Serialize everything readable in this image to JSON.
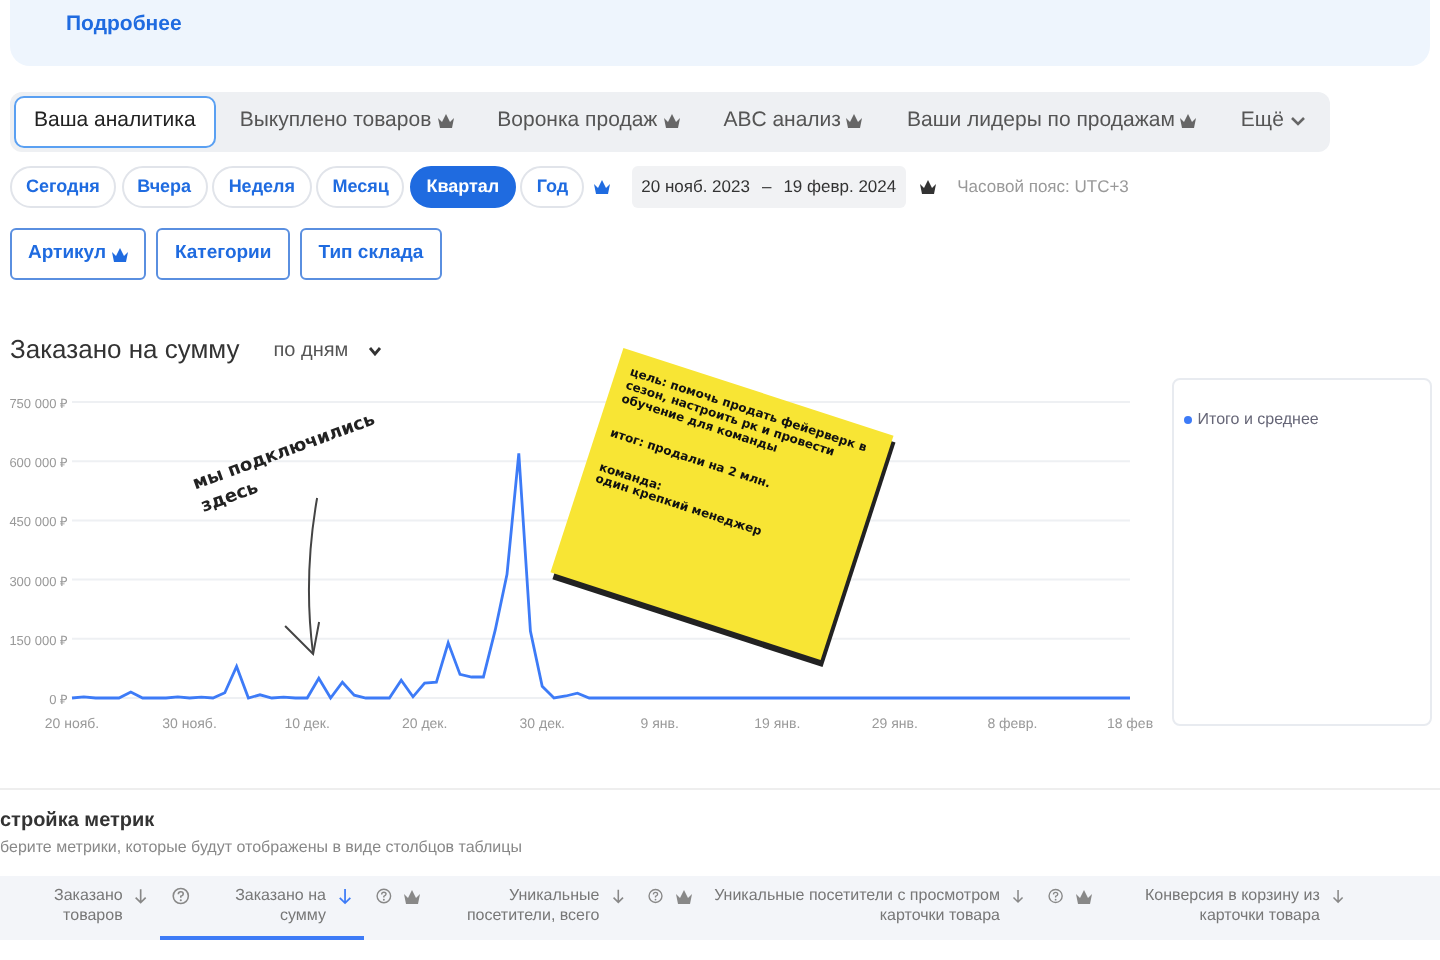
{
  "banner": {
    "link": "Подробнее"
  },
  "tabs": [
    {
      "label": "Ваша аналитика",
      "selected": true,
      "premium": false,
      "dropdown": false
    },
    {
      "label": "Выкуплено товаров",
      "selected": false,
      "premium": true,
      "dropdown": false
    },
    {
      "label": "Воронка продаж",
      "selected": false,
      "premium": true,
      "dropdown": false
    },
    {
      "label": "ABC анализ",
      "selected": false,
      "premium": true,
      "dropdown": false
    },
    {
      "label": "Ваши лидеры по продажам",
      "selected": false,
      "premium": true,
      "dropdown": false
    },
    {
      "label": "Ещё",
      "selected": false,
      "premium": false,
      "dropdown": true
    }
  ],
  "periods": [
    {
      "label": "Сегодня",
      "selected": false
    },
    {
      "label": "Вчера",
      "selected": false
    },
    {
      "label": "Неделя",
      "selected": false
    },
    {
      "label": "Месяц",
      "selected": false
    },
    {
      "label": "Квартал",
      "selected": true
    },
    {
      "label": "Год",
      "selected": false
    }
  ],
  "periods_premium": true,
  "date_range": {
    "from": "20 нояб. 2023",
    "separator": "–",
    "to": "19 февр. 2024",
    "premium": true
  },
  "timezone": "Часовой пояс: UTC+3",
  "filters": [
    {
      "label": "Артикул",
      "premium": true
    },
    {
      "label": "Категории",
      "premium": false
    },
    {
      "label": "Тип склада",
      "premium": false
    }
  ],
  "chart_section": {
    "title": "Заказано на сумму",
    "granularity": "по дням",
    "chart_data": {
      "type": "line",
      "categories": [
        "20 нояб.",
        null,
        null,
        null,
        null,
        null,
        null,
        null,
        null,
        null,
        "30 нояб.",
        null,
        null,
        null,
        null,
        null,
        null,
        null,
        null,
        null,
        "10 дек.",
        null,
        null,
        null,
        null,
        null,
        null,
        null,
        null,
        null,
        "20 дек.",
        null,
        null,
        null,
        null,
        null,
        null,
        null,
        null,
        null,
        "30 дек.",
        null,
        null,
        null,
        null,
        null,
        null,
        null,
        null,
        null,
        "9 янв.",
        null,
        null,
        null,
        null,
        null,
        null,
        null,
        null,
        null,
        "19 янв.",
        null,
        null,
        null,
        null,
        null,
        null,
        null,
        null,
        null,
        "29 янв.",
        null,
        null,
        null,
        null,
        null,
        null,
        null,
        null,
        null,
        "8 февр.",
        null,
        null,
        null,
        null,
        null,
        null,
        null,
        null,
        null,
        "18 фев"
      ],
      "series": [
        {
          "name": "Итого и среднее",
          "color": "#3d7bf7",
          "values": [
            0,
            3000,
            0,
            0,
            0,
            15000,
            0,
            0,
            0,
            3000,
            0,
            2000,
            0,
            13000,
            80000,
            0,
            8000,
            0,
            2000,
            0,
            0,
            50000,
            0,
            40000,
            7000,
            0,
            0,
            0,
            45000,
            3000,
            38000,
            40000,
            140000,
            60000,
            53000,
            53000,
            172000,
            313000,
            620000,
            170000,
            30000,
            0,
            5000,
            12000,
            0,
            0,
            0,
            0,
            0,
            0,
            0,
            0,
            0,
            0,
            0,
            0,
            0,
            0,
            0,
            0,
            0,
            0,
            0,
            0,
            0,
            0,
            0,
            0,
            0,
            0,
            0,
            0,
            0,
            0,
            0,
            0,
            0,
            0,
            0,
            0,
            0,
            0,
            0,
            0,
            0,
            0,
            0,
            0,
            0,
            0,
            0
          ]
        }
      ],
      "ylim": [
        0,
        750000
      ],
      "yticks": [
        {
          "value": 0,
          "label": "0 ₽"
        },
        {
          "value": 150000,
          "label": "150 000 ₽"
        },
        {
          "value": 300000,
          "label": "300 000 ₽"
        },
        {
          "value": 450000,
          "label": "450 000 ₽"
        },
        {
          "value": 600000,
          "label": "600 000 ₽"
        },
        {
          "value": 750000,
          "label": "750 000 ₽"
        }
      ],
      "grid": true
    },
    "callout": {
      "text": "мы подключились здесь"
    }
  },
  "sticky_note": {
    "paragraphs": [
      "цель: помочь продать фейерверк в сезон, настроить рк и провести обучение для команды",
      "итог: продали на 2 млн.",
      "команда:\nодин крепкий менеджер"
    ]
  },
  "metrics": {
    "title": "стройка метрик",
    "subtitle": "берите метрики, которые будут отображены в виде столбцов таблицы",
    "columns": [
      {
        "label": "Заказано товаров",
        "help": false,
        "premium": false,
        "selected": false
      },
      {
        "label": "Заказано на сумму",
        "help": true,
        "premium": false,
        "selected": true
      },
      {
        "label": "Уникальные посетители, всего",
        "help": true,
        "premium": true,
        "selected": false
      },
      {
        "label": "Уникальные посетители с просмотром карточки товара",
        "help": true,
        "premium": true,
        "selected": false
      },
      {
        "label": "Конверсия в корзину из карточки товара",
        "help": true,
        "premium": true,
        "selected": false
      }
    ]
  }
}
